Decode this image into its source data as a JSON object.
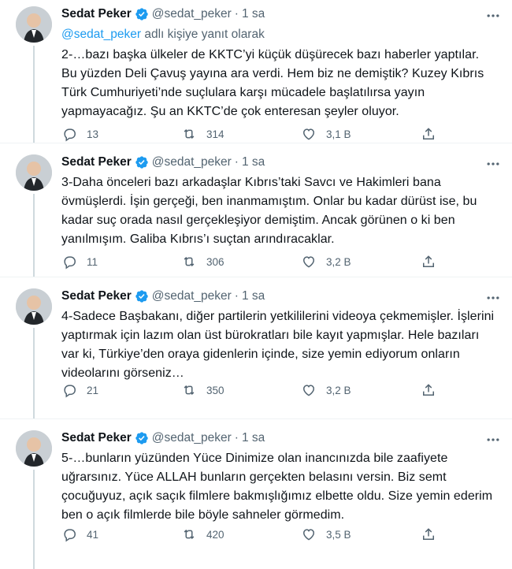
{
  "colors": {
    "accent": "#1d9bf0",
    "muted": "#536471",
    "text": "#0f1419",
    "thread_line": "#cfd9de"
  },
  "tweets": [
    {
      "name": "Sedat Peker",
      "handle": "@sedat_peker",
      "dot": "·",
      "time": "1 sa",
      "reply_handle": "@sedat_peker",
      "reply_text": " adlı kişiye yanıt olarak",
      "text": "2-…bazı başka ülkeler de KKTC’yi küçük düşürecek bazı haberler yaptılar. Bu yüzden Deli Çavuş yayına ara verdi. Hem biz ne demiştik? Kuzey Kıbrıs Türk Cumhuriyeti’nde suçlulara karşı mücadele başlatılırsa yayın yapmayacağız. Şu an KKTC’de çok enteresan şeyler oluyor.",
      "replies": "13",
      "retweets": "314",
      "likes": "3,1 B"
    },
    {
      "name": "Sedat Peker",
      "handle": "@sedat_peker",
      "dot": "·",
      "time": "1 sa",
      "text": "3-Daha önceleri bazı arkadaşlar Kıbrıs’taki Savcı ve Hakimleri bana övmüşlerdi. İşin gerçeği, ben inanmamıştım. Onlar bu kadar dürüst ise, bu kadar suç orada nasıl gerçekleşiyor demiştim. Ancak görünen o ki ben yanılmışım. Galiba Kıbrıs’ı suçtan arındıracaklar.",
      "replies": "11",
      "retweets": "306",
      "likes": "3,2 B"
    },
    {
      "name": "Sedat Peker",
      "handle": "@sedat_peker",
      "dot": "·",
      "time": "1 sa",
      "text": "4-Sadece Başbakanı, diğer partilerin yetkililerini videoya çekmemişler. İşlerini yaptırmak için lazım olan üst bürokratları bile kayıt yapmışlar. Hele bazıları var ki, Türkiye’den oraya gidenlerin içinde, size yemin ediyorum onların videolarını görseniz…",
      "replies": "21",
      "retweets": "350",
      "likes": "3,2 B"
    },
    {
      "name": "Sedat Peker",
      "handle": "@sedat_peker",
      "dot": "·",
      "time": "1 sa",
      "text": "5-…bunların yüzünden Yüce Dinimize olan inancınızda bile zaafiyete uğrarsınız. Yüce ALLAH bunların gerçekten belasını versin. Biz semt çocuğuyuz, açık saçık filmlere bakmışlığımız elbette oldu. Size yemin ederim ben o açık filmlerde bile böyle sahneler görmedim.",
      "replies": "41",
      "retweets": "420",
      "likes": "3,5 B"
    }
  ]
}
